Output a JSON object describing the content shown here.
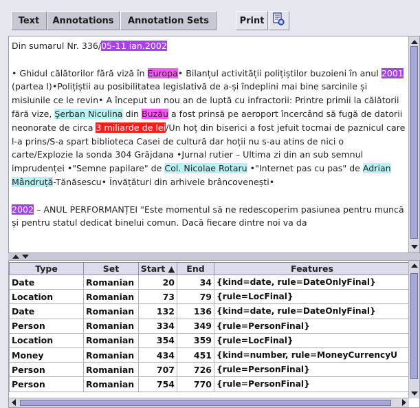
{
  "toolbar": {
    "tabs": [
      "Text",
      "Annotations",
      "Annotation Sets"
    ],
    "print_label": "Print",
    "icon": "document-settings-icon"
  },
  "document": {
    "header_prefix": "Din sumarul Nr. 336/",
    "header_date": "05-11 ian.2002",
    "p1": {
      "s1": "• Ghidul călătorilor fără viză în ",
      "e_europa": "Europa",
      "s2": "• Bilanțul activității polițiștilor buzoieni în anul ",
      "e_2001": "2001",
      "s3": " (partea I)•Polițiștii au posibilitatea legislativă de a-și îndeplini mai bine sarcinile și misiunile ce le revin• A început un nou an de luptă cu infractorii: Printre primii la călătorii fără vize, ",
      "e_serban": "Şerban Niculina",
      "s4": " din ",
      "e_buzau": "Buzău",
      "s5": " a fost prinsă pe aeroport încercând să fugă de datorii neonorate de circa ",
      "e_money": "3 miliarde de lei",
      "s6": "/Un hoț din biserici a fost jefuit tocmai de paznicul care l-a prins/S-a spart biblioteca Casei de cultură dar hoții nu s-au atins de nici o carte/Explozie la sonda 304 Grăjdana •Jurnal rutier – Ultima zi din an sub semnul imprudenței •\"Semne papilare\" de ",
      "e_rotaru": "Col. Nicolae Rotaru",
      "s7": " •\"Internet pas cu pas\" de ",
      "e_adrian": "Adrian Mândruță",
      "s8": "-Tănăsescu• Învățături din arhivele brâncovenești•"
    },
    "p2": {
      "e_2002": "2002",
      "s1": " – ANUL PERFORMANȚEI \"Este momentul să ne redescoperim pasiunea pentru muncă și pentru statul dedicat binelui comun. Dacă fiecare dintre noi va da"
    }
  },
  "table": {
    "headers": [
      "Type",
      "Set",
      "Start ▲",
      "End",
      "Features"
    ],
    "rows": [
      {
        "type": "Date",
        "set": "Romanian",
        "start": "20",
        "end": "34",
        "features": "{kind=date, rule=DateOnlyFinal}"
      },
      {
        "type": "Location",
        "set": "Romanian",
        "start": "73",
        "end": "79",
        "features": "{rule=LocFinal}"
      },
      {
        "type": "Date",
        "set": "Romanian",
        "start": "132",
        "end": "136",
        "features": "{kind=date, rule=DateOnlyFinal}"
      },
      {
        "type": "Person",
        "set": "Romanian",
        "start": "334",
        "end": "349",
        "features": "{rule=PersonFinal}"
      },
      {
        "type": "Location",
        "set": "Romanian",
        "start": "354",
        "end": "359",
        "features": "{rule=LocFinal}"
      },
      {
        "type": "Money",
        "set": "Romanian",
        "start": "434",
        "end": "451",
        "features": "{kind=number, rule=MoneyCurrencyU"
      },
      {
        "type": "Person",
        "set": "Romanian",
        "start": "707",
        "end": "726",
        "features": "{rule=PersonFinal}"
      },
      {
        "type": "Person",
        "set": "Romanian",
        "start": "754",
        "end": "770",
        "features": "{rule=PersonFinal}"
      }
    ]
  },
  "colors": {
    "date": "#b03cf0",
    "location": "#ff55ff",
    "person": "#b8f2f4",
    "money": "#ff1c1c"
  }
}
